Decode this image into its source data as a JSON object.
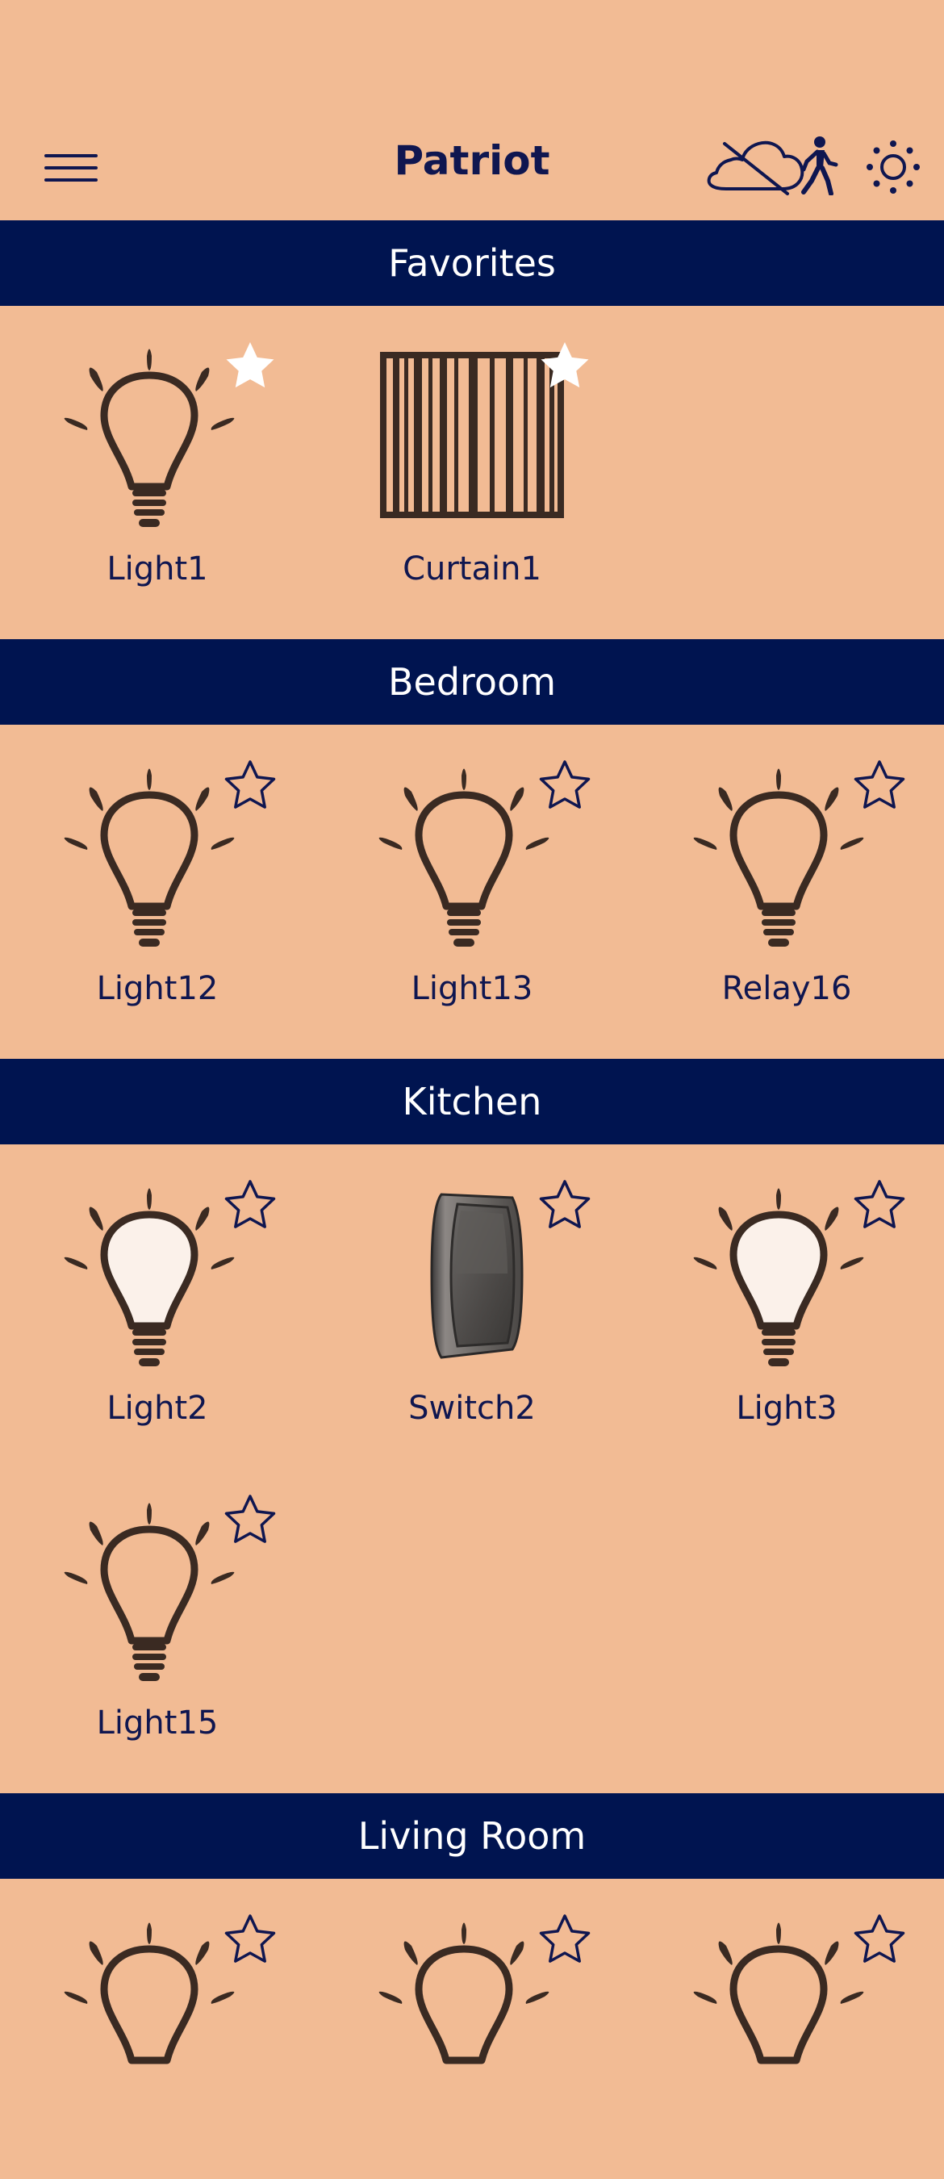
{
  "app": {
    "title": "Patriot",
    "icons": [
      "menu-icon",
      "cloud-off-icon",
      "walking-person-icon",
      "brightness-icon"
    ]
  },
  "colors": {
    "background": "#F2BB94",
    "section_header": "#001450",
    "accent": "#0F1650",
    "icon_stroke": "#3A2A22"
  },
  "sections": [
    {
      "title": "Favorites",
      "devices": [
        {
          "label": "Light1",
          "icon": "light-bulb-icon",
          "state": "off",
          "favorite": true
        },
        {
          "label": "Curtain1",
          "icon": "curtain-icon",
          "state": "closed",
          "favorite": true
        }
      ]
    },
    {
      "title": "Bedroom",
      "devices": [
        {
          "label": "Light12",
          "icon": "light-bulb-icon",
          "state": "off",
          "favorite": false
        },
        {
          "label": "Light13",
          "icon": "light-bulb-icon",
          "state": "off",
          "favorite": false
        },
        {
          "label": "Relay16",
          "icon": "light-bulb-icon",
          "state": "off",
          "favorite": false
        }
      ]
    },
    {
      "title": "Kitchen",
      "devices": [
        {
          "label": "Light2",
          "icon": "light-bulb-icon",
          "state": "on",
          "favorite": false
        },
        {
          "label": "Switch2",
          "icon": "wall-switch-icon",
          "state": "off",
          "favorite": false
        },
        {
          "label": "Light3",
          "icon": "light-bulb-icon",
          "state": "on",
          "favorite": false
        },
        {
          "label": "Light15",
          "icon": "light-bulb-icon",
          "state": "off",
          "favorite": false
        }
      ]
    },
    {
      "title": "Living Room",
      "devices": [
        {
          "label": "",
          "icon": "light-bulb-icon",
          "state": "off",
          "favorite": false
        },
        {
          "label": "",
          "icon": "light-bulb-icon",
          "state": "off",
          "favorite": false
        },
        {
          "label": "",
          "icon": "light-bulb-icon",
          "state": "off",
          "favorite": false
        }
      ]
    }
  ]
}
